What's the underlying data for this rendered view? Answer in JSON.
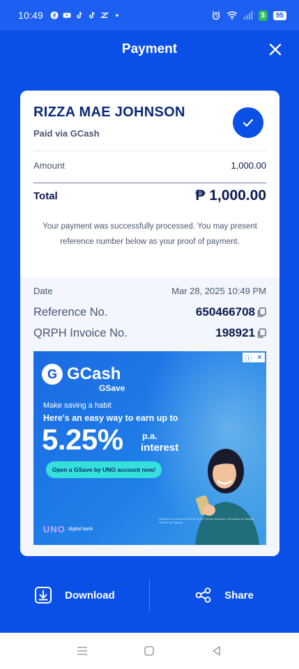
{
  "status_bar": {
    "time": "10:49",
    "battery": "95",
    "money_badge": "$"
  },
  "header": {
    "title": "Payment"
  },
  "receipt": {
    "recipient_name": "RIZZA MAE JOHNSON",
    "paid_via": "Paid via GCash",
    "amount_label": "Amount",
    "amount_value": "1,000.00",
    "total_label": "Total",
    "total_value": "₱ 1,000.00",
    "message": "Your payment was successfully processed. You may present reference number below as your proof of payment.",
    "date_label": "Date",
    "date_value": "Mar 28, 2025 10:49 PM",
    "reference_label": "Reference No.",
    "reference_value": "650466708",
    "qrph_label": "QRPH Invoice No.",
    "qrph_value": "198921"
  },
  "ad": {
    "badge_info": "ⓘ",
    "badge_close": "✕",
    "brand_initial": "G",
    "brand": "GCash",
    "product": "GSave",
    "tagline": "Make saving a habit",
    "headline": "Here's an easy way to earn up to",
    "rate": "5.25%",
    "rate_suffix": "p.a.",
    "rate_word": "interest",
    "cta": "Open a GSave by UNO account now!",
    "partner_mark": "UNO",
    "partner_text": "digital bank",
    "fineprint": "Deposits are insured by PDIC up to P1M per depositor. Regulated by Bangko Sentral ng Pilipinas."
  },
  "actions": {
    "download_label": "Download",
    "share_label": "Share"
  },
  "colors": {
    "brand_blue": "#0a50e6",
    "card_bg": "#ffffff",
    "text_dark": "#0b1a4f",
    "text_muted": "#4a5670",
    "cta_teal": "#35e0da"
  },
  "icons": {
    "close": "close-icon",
    "check": "check-icon",
    "copy": "copy-icon",
    "download": "download-icon",
    "share": "share-icon",
    "nav_menu": "menu-icon",
    "nav_home": "home-icon",
    "nav_back": "back-icon"
  }
}
